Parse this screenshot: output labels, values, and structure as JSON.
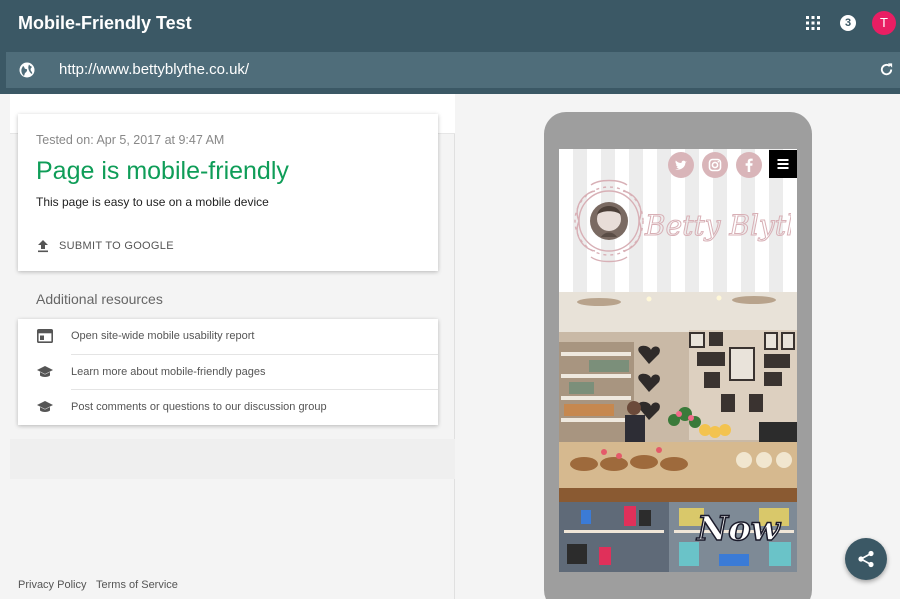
{
  "header": {
    "title": "Mobile-Friendly Test",
    "notifications_count": "3",
    "avatar_initial": "T",
    "apps_icon": "apps-grid-icon"
  },
  "urlbar": {
    "url": "http://www.bettyblythe.co.uk/",
    "left_icon": "globe-icon",
    "right_icon": "refresh-icon"
  },
  "result": {
    "tested_on": "Tested on: Apr 5, 2017 at 9:47 AM",
    "heading": "Page is mobile-friendly",
    "description": "This page is easy to use on a mobile device",
    "submit_label": "SUBMIT TO GOOGLE"
  },
  "resources": {
    "title": "Additional resources",
    "items": [
      {
        "label": "Open site-wide mobile usability report",
        "icon": "report-icon"
      },
      {
        "label": "Learn more about mobile-friendly pages",
        "icon": "school-icon"
      },
      {
        "label": "Post comments or questions to our discussion group",
        "icon": "school-icon"
      }
    ]
  },
  "footer": {
    "privacy": "Privacy Policy",
    "terms": "Terms of Service"
  },
  "preview": {
    "logo_text": "Betty Blythe",
    "banner_text": "Now",
    "social_icons": [
      "twitter-icon",
      "instagram-icon",
      "facebook-icon"
    ]
  },
  "colors": {
    "header_bg": "#3b5865",
    "urlbar_bg": "#4f6d7a",
    "success_green": "#0f9d58",
    "avatar_pink": "#e91e63",
    "phone_frame": "#9e9e9e"
  }
}
